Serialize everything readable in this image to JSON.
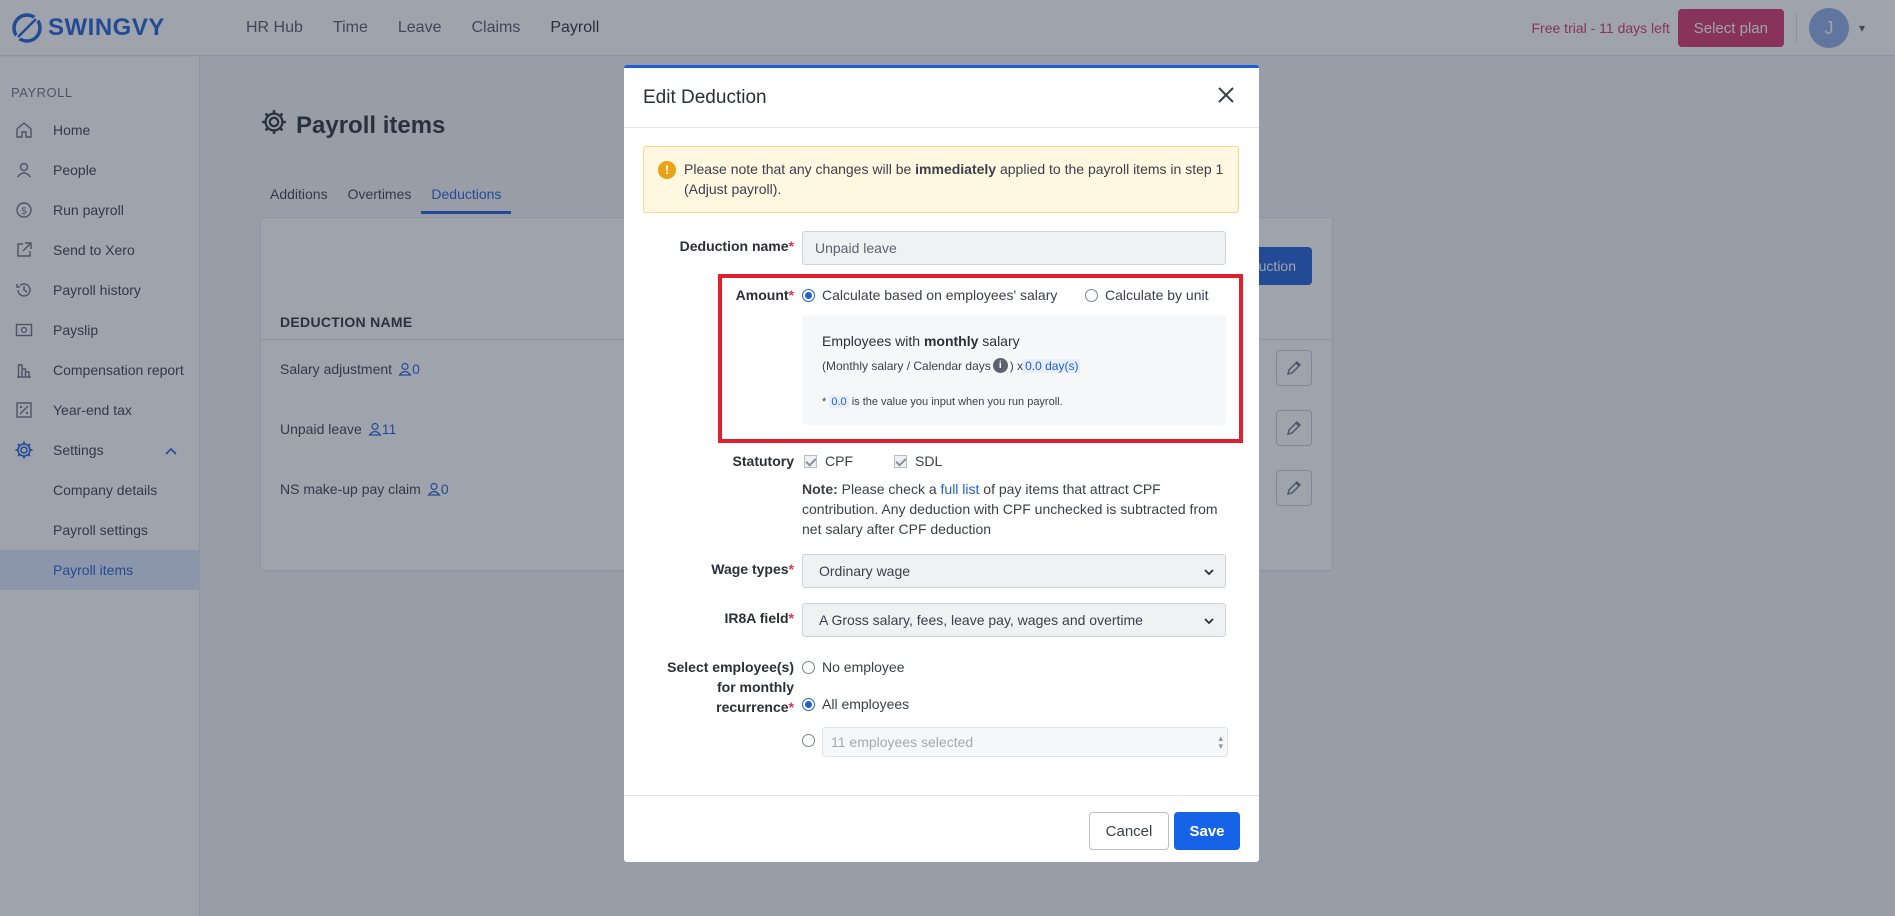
{
  "brand": {
    "name": "SWINGVY"
  },
  "nav": {
    "items": [
      "HR Hub",
      "Time",
      "Leave",
      "Claims",
      "Payroll"
    ]
  },
  "topbar": {
    "trial_text": "Free trial - 11 days left",
    "select_plan_label": "Select plan",
    "avatar_initial": "J"
  },
  "sidebar": {
    "section_label": "PAYROLL",
    "items": [
      {
        "label": "Home",
        "icon": "home-icon"
      },
      {
        "label": "People",
        "icon": "person-icon"
      },
      {
        "label": "Run payroll",
        "icon": "dollar-cycle-icon"
      },
      {
        "label": "Send to Xero",
        "icon": "external-link-icon"
      },
      {
        "label": "Payroll history",
        "icon": "history-icon"
      },
      {
        "label": "Payslip",
        "icon": "payslip-icon"
      },
      {
        "label": "Compensation report",
        "icon": "bar-chart-icon"
      },
      {
        "label": "Year-end tax",
        "icon": "percent-icon"
      },
      {
        "label": "Settings",
        "icon": "gear-icon"
      }
    ],
    "settings_sub": [
      "Company details",
      "Payroll settings",
      "Payroll items"
    ]
  },
  "main": {
    "title": "Payroll items",
    "tabs": [
      "Additions",
      "Overtimes",
      "Deductions"
    ],
    "add_button_label": "uction",
    "column_header": "DEDUCTION NAME",
    "rows": [
      {
        "name": "Salary adjustment",
        "count": "0"
      },
      {
        "name": "Unpaid leave",
        "count": "11"
      },
      {
        "name": "NS make-up pay claim",
        "count": "0"
      }
    ]
  },
  "modal": {
    "title": "Edit Deduction",
    "alert": {
      "before": "Please note that any changes will be ",
      "bold": "immediately",
      "after": " applied to the payroll items in step 1 (Adjust payroll)."
    },
    "deduction_name": {
      "label": "Deduction name",
      "value": "Unpaid leave"
    },
    "amount": {
      "label": "Amount",
      "option_salary": "Calculate based on employees' salary",
      "option_unit": "Calculate by unit",
      "formula_heading_pre": "Employees with ",
      "formula_heading_bold": "monthly",
      "formula_heading_post": " salary",
      "formula_pre": "(Monthly salary / Calendar days ",
      "formula_mid": ") x ",
      "formula_days": "0.0 day(s)",
      "footnote_pre": "* ",
      "footnote_value": "0.0",
      "footnote_post": " is the value you input when you run payroll."
    },
    "statutory": {
      "label": "Statutory",
      "cpf": "CPF",
      "sdl": "SDL",
      "note_bold": "Note:",
      "note_pre": " Please check a ",
      "note_link": "full list",
      "note_post": " of pay items that attract CPF contribution. Any deduction with CPF unchecked is subtracted from net salary after CPF deduction"
    },
    "wage_types": {
      "label": "Wage types",
      "value": "Ordinary wage"
    },
    "ir8a": {
      "label": "IR8A field",
      "value": "A Gross salary, fees, leave pay, wages and overtime"
    },
    "recurrence": {
      "label_line1": "Select employee(s)",
      "label_line2": "for monthly",
      "label_line3": "recurrence",
      "option_none": "No employee",
      "option_all": "All employees",
      "selected_placeholder": "11 employees selected"
    },
    "cancel_label": "Cancel",
    "save_label": "Save"
  }
}
